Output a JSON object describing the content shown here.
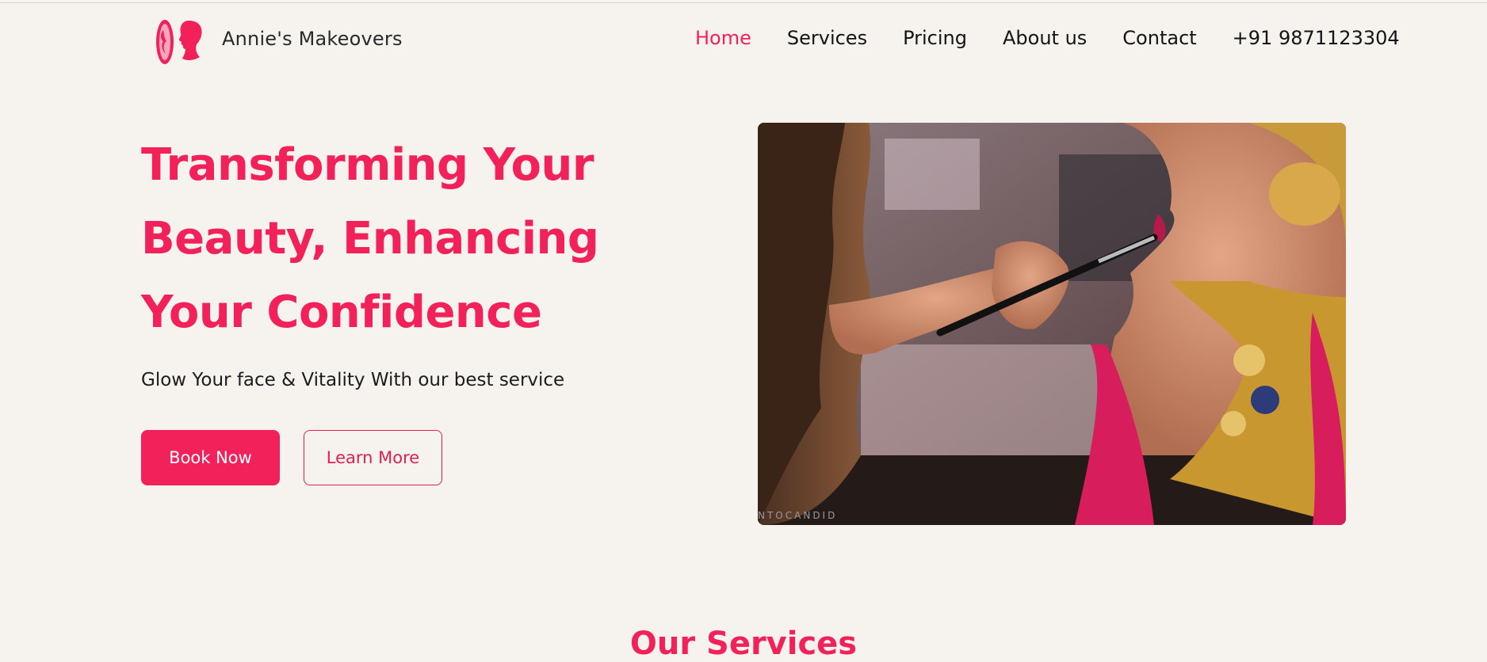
{
  "brand": {
    "name": "Annie's Makeovers",
    "logo_icon": "woman-silhouette-logo-icon",
    "accent": "#f2215a"
  },
  "nav": {
    "items": [
      {
        "label": "Home",
        "active": true
      },
      {
        "label": "Services",
        "active": false
      },
      {
        "label": "Pricing",
        "active": false
      },
      {
        "label": "About us",
        "active": false
      },
      {
        "label": "Contact",
        "active": false
      }
    ],
    "phone": "+91 9871123304"
  },
  "hero": {
    "title_lines": [
      "Transforming Your",
      "Beauty, Enhancing",
      "Your Confidence"
    ],
    "subtitle": "Glow Your face & Vitality With our best service",
    "primary_button": "Book Now",
    "secondary_button": "Learn More",
    "image_watermark": "NTOCANDID"
  },
  "services": {
    "title": "Our Services"
  }
}
